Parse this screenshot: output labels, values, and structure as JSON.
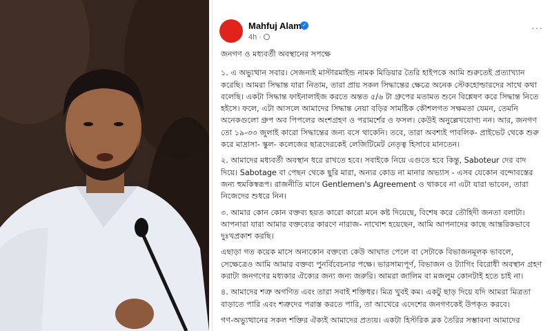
{
  "post": {
    "author": "Mahfuj Alam",
    "time": "4h ·",
    "more_label": "···",
    "verified_mark": "✓",
    "title": "জনগণ ও মধ্যবর্তী অবস্থানের সপক্ষে",
    "paragraphs": [
      "১. এ অভ্যুত্থান সবার। সেজন্যই মাস্টারমাইন্ড নামক মিডিয়ার তৈরি হাইপকে আমি শুরুতেই প্রত্যাখ্যান করেছি। আমরা সিদ্ধান্ত যারা নিতাম, তারা প্রায় সকল সিদ্ধান্তের ক্ষেত্রে অনেক স্টেকহোল্ডারদের সাথে কথা বলেছি। একটা সিদ্ধান্ত ফাইনালাইজ করতে অন্তত ৫/৬ টা গ্রুপের মতামত শুনে বিশ্লেষণ করে সিদ্ধান্ত নিতে হইসে। ফলে, এটা আসলে আমাদের সিদ্ধান্ত নেয়া বড়ির সামষ্টিক কৌশলগত সক্ষমতা যেমন, তেমনি অনেকগুলো গ্রুপ অব পিপলের অংশগ্রহণ ও পরামর্শের ও ফসল। কেউই অনুল্লেখযোগ্য নন। আর, জনগণ তো ১৯-৩৩ জুলাই কারো সিদ্ধান্তের জন্য বসে থাকেনি। তবে, তারা অবশ্যই পাবলিক- প্রাইভেট থেকে শুরু করে মাদ্রাসা- স্কুল- কলেজের ছাত্রদেরকেই লেজিটিমেট নেতৃত্ব হিসাবে মানতেন।",
      "২. আমাদের মধ্যবর্তী অবস্থান ধরে রাখতে হবে। সবাইকে নিয়ে এগুতে হবে কিন্তু, Saboteur দের বাদ দিয়ে। Sabotage বা পেছন থেকে ছুরি মারা, অন্যর কোড না মানার অভ্যাস - এসব যেকোন বন্দোবস্তের জন্য হুমকিস্বরূপ। রাজনীতি মানে Gentlemen's Agreement ও থাকবে না এটা যারা ভাবেন, তারা নিজেদের শুধরে নিন।",
      "৩. আমার কোন কোন বক্তব্য হয়ত কারো কারো মনে কষ্ট দিয়েছে, বিশেষ করে তৌহিদী জনতা বলাটা। আপনারা যারা আমার বক্তব্যের কারণে নারাজ- নাখোশ হয়েছেন, আমি আপনাদের কাছে আন্তরিকভাবে দুঃখপ্রকাশ করছি।",
      "এছাড়া গত কয়েক মাসে অন্যকোন বক্তব্যে কেউ আঘাত পেলে বা সেটাকে বিভাজনমূলক ভাবলে, সেক্ষেত্রেও আমি আমার বক্তব্য পুনর্বিবেচনার পক্ষে। ভারসাম্যপূর্ণ, বিভাজন ও ট্যাগিং বিরোধী অবস্থান গ্রহণ করাটা জনগণের মধ্যকার ঐক্যের জন্য জন্য জরুরি। আমরা জালিম বা মজলুম কোনটাই হতে চাই না।",
      "৪. আমাদের শত্রু অগণিত এবং তারা সবাই শক্তিধর। মিত্র খুবই কম। একটু ছাড় দিয়ে যদি আমরা মিত্রতা বাড়াতে পারি এবং শত্রুদের পরাস্ত করতে পারি, তা আখেরে এদেশের জনগণকেই উপকৃত করবে।",
      "গণ-অভ্যুত্থানের সকল শক্তির ঐক্যই আমাদের প্রত্যয়। একটা হিস্টরিক ব্লক তৈরির সম্ভাবনা আমাদের"
    ]
  },
  "colors": {
    "avatar": "#e0231b",
    "verified": "#1877f2",
    "text": "#1c1e21",
    "meta": "#65676b"
  },
  "icons": [
    "verified-badge-icon",
    "globe-icon",
    "more-options-icon",
    "microphone-icon"
  ]
}
